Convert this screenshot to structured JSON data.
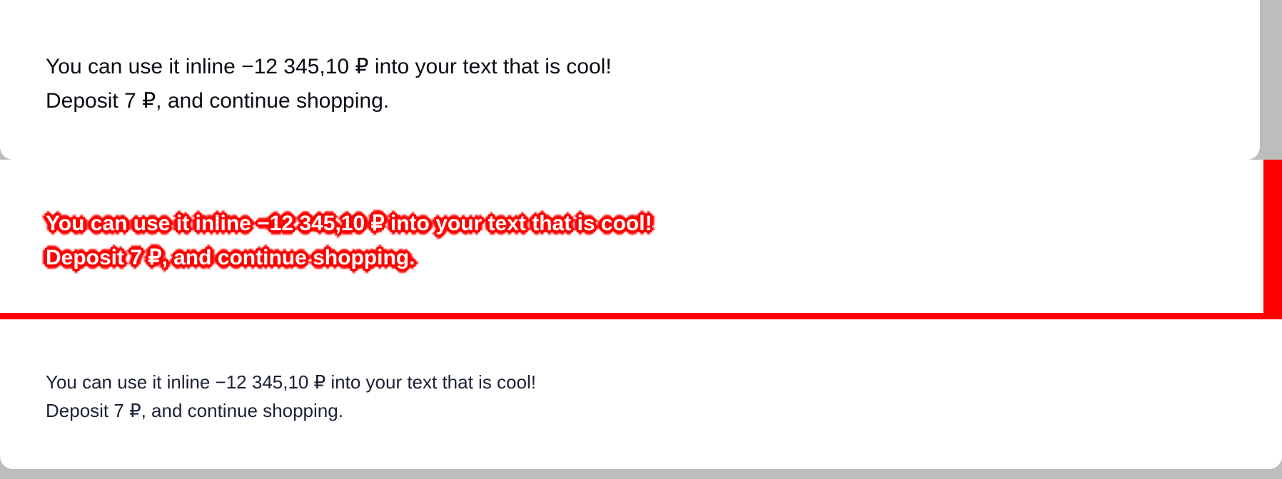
{
  "samples": [
    {
      "line1": "You can use it inline −12 345,10 ₽ into your text that is cool!",
      "line2": "Deposit 7 ₽, and continue shopping."
    },
    {
      "line1": "You can use it inline −12 345,10 ₽ into your text that is cool!",
      "line2": "Deposit 7 ₽, and continue shopping."
    },
    {
      "line1": "You can use it inline −12 345,10 ₽ into your text that is cool!",
      "line2": "Deposit 7 ₽, and continue shopping."
    }
  ],
  "colors": {
    "page_background": "#bdbdbd",
    "panel_background": "#ffffff",
    "highlight_red": "#ff0000",
    "text_dark": "#0b0b14",
    "text_navy": "#1b2036"
  }
}
